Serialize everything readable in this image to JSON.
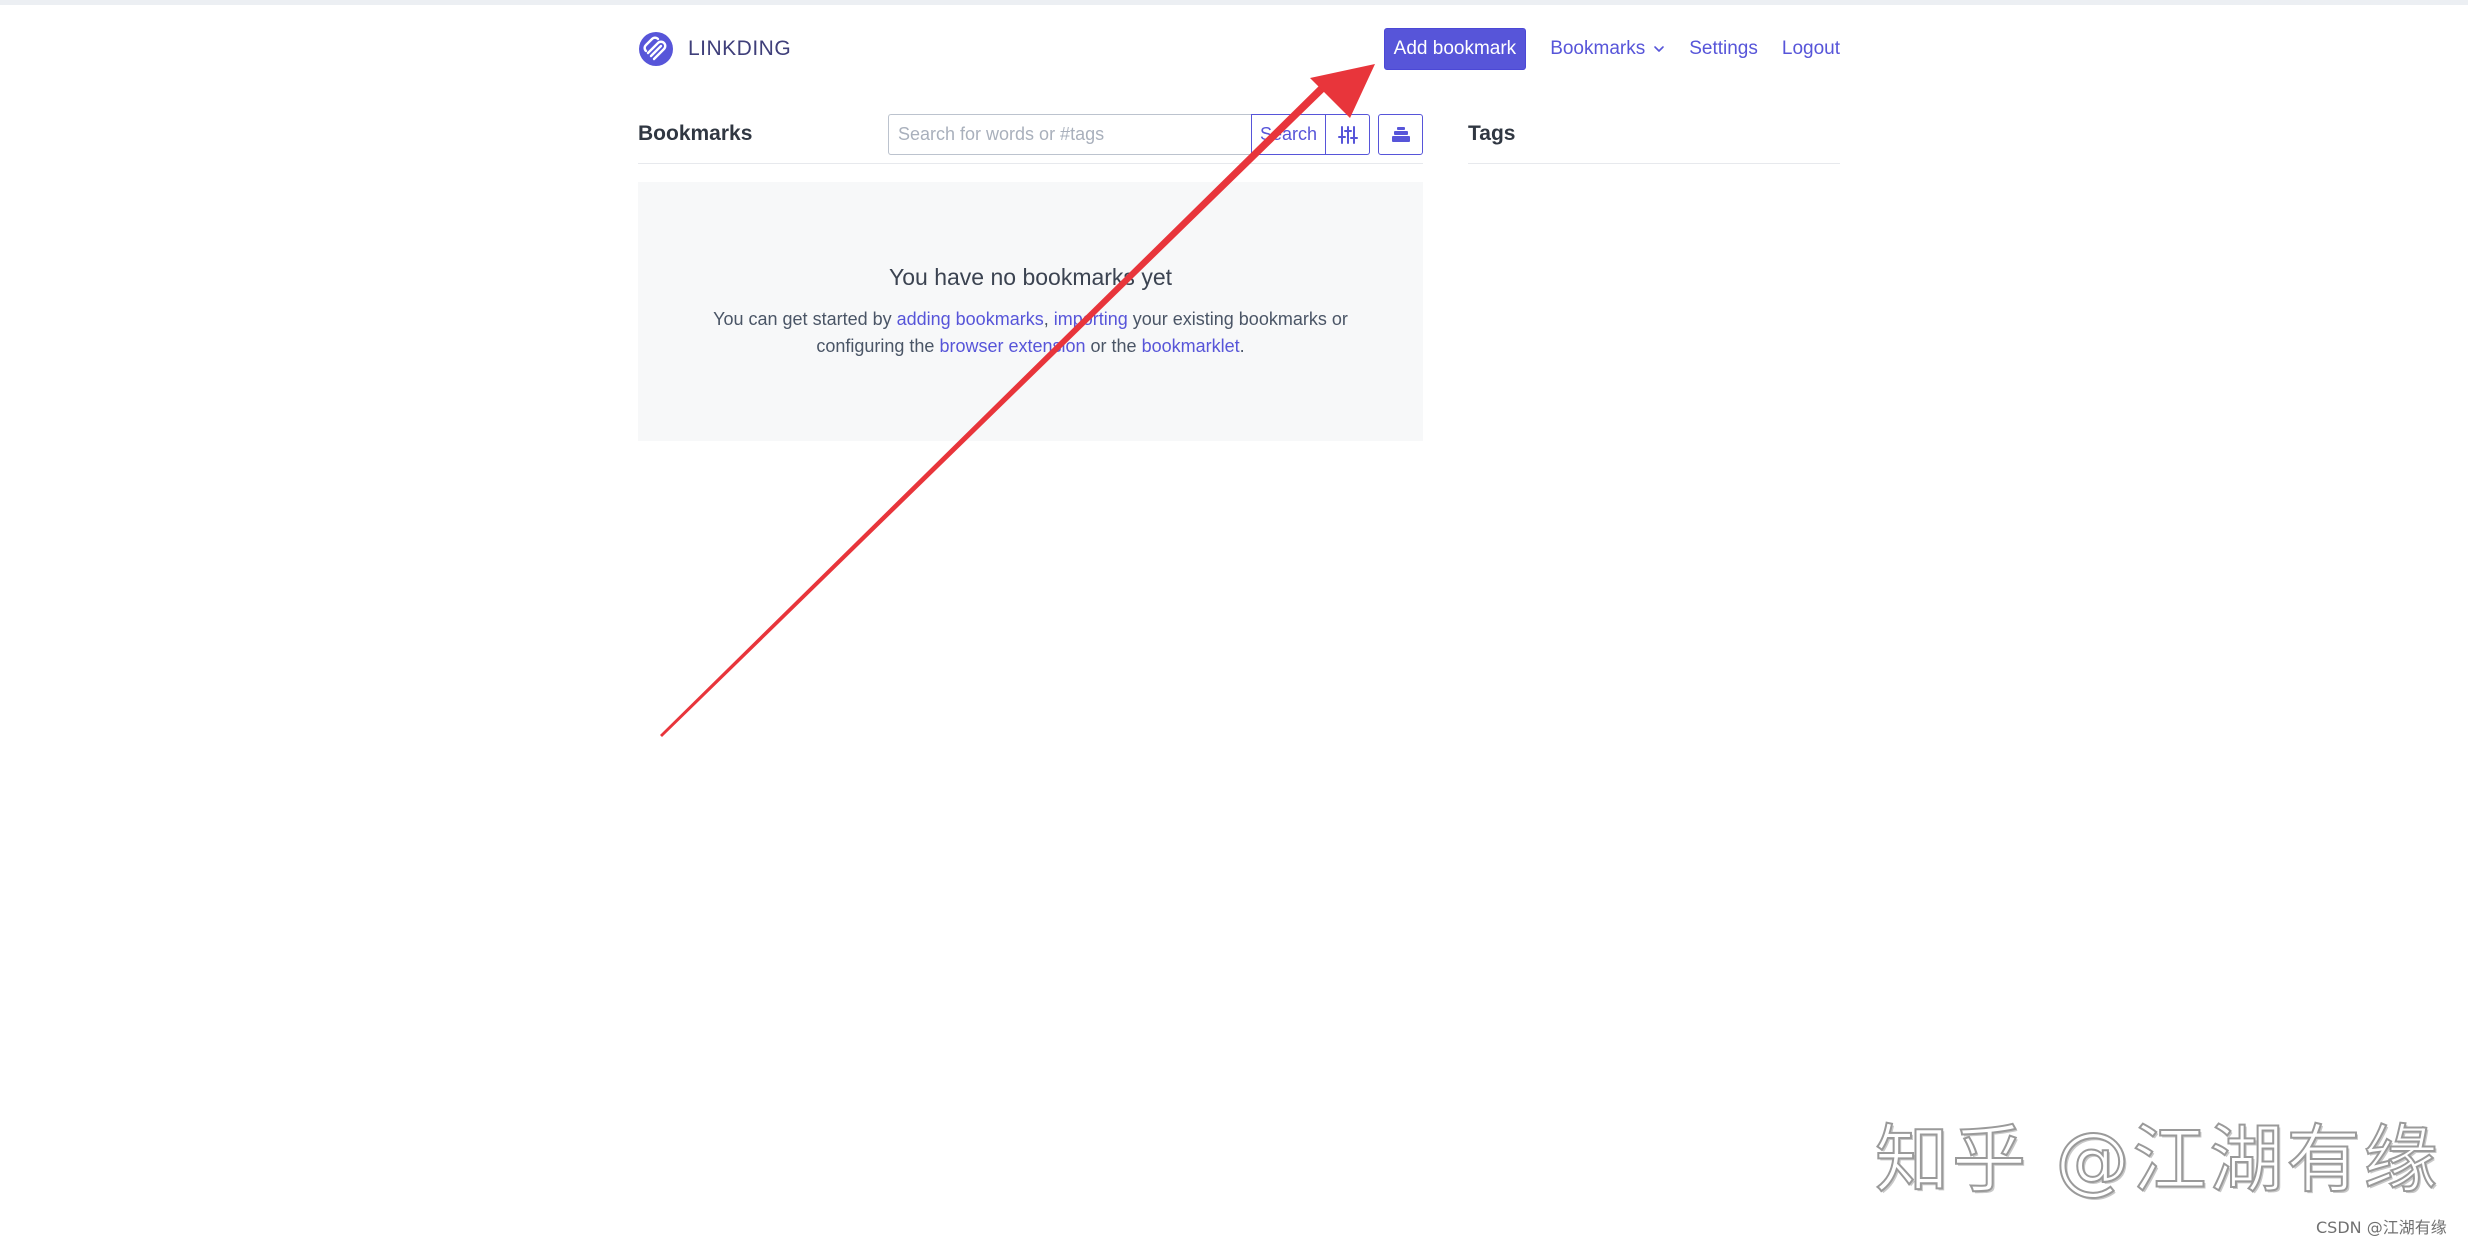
{
  "app": {
    "brand": "LINKDING"
  },
  "nav": {
    "add_bookmark": "Add bookmark",
    "bookmarks": "Bookmarks",
    "settings": "Settings",
    "logout": "Logout"
  },
  "bookmarks": {
    "title": "Bookmarks",
    "search_placeholder": "Search for words or #tags",
    "search_button": "Search"
  },
  "empty_state": {
    "title": "You have no bookmarks yet",
    "text_1": "You can get started by ",
    "link_adding": "adding bookmarks",
    "text_2": ", ",
    "link_importing": "importing",
    "text_3": " your existing bookmarks or configuring the ",
    "link_extension": "browser extension",
    "text_4": " or the ",
    "link_bookmarklet": "bookmarklet",
    "text_5": "."
  },
  "tags": {
    "title": "Tags"
  },
  "watermark": {
    "large": "知乎 @江湖有缘",
    "small": "CSDN @江湖有缘"
  },
  "colors": {
    "primary": "#5755d9",
    "annotation_arrow": "#e8353b",
    "empty_bg": "#f7f8f9"
  }
}
